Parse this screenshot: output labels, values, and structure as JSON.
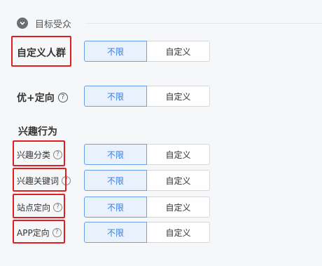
{
  "section": {
    "title": "目标受众",
    "icon": "chevron-down-icon"
  },
  "groups": {
    "interest": "兴趣行为"
  },
  "rows": [
    {
      "label": "自定义人群",
      "help": false,
      "options": [
        "不限",
        "自定义"
      ],
      "selected": "不限"
    },
    {
      "label": "优+定向",
      "help": true,
      "options": [
        "不限",
        "自定义"
      ],
      "selected": "不限"
    },
    {
      "label": "兴趣分类",
      "help": true,
      "options": [
        "不限",
        "自定义"
      ],
      "selected": "不限"
    },
    {
      "label": "兴趣关键词",
      "help": true,
      "options": [
        "不限",
        "自定义"
      ],
      "selected": "不限"
    },
    {
      "label": "站点定向",
      "help": true,
      "options": [
        "不限",
        "自定义"
      ],
      "selected": "不限"
    },
    {
      "label": "APP定向",
      "help": true,
      "options": [
        "不限",
        "自定义"
      ],
      "selected": "不限"
    }
  ],
  "help_glyph": "?",
  "colors": {
    "accent": "#3b7ddd",
    "active_bg": "#e9f1fd",
    "highlight": "#e02020"
  }
}
